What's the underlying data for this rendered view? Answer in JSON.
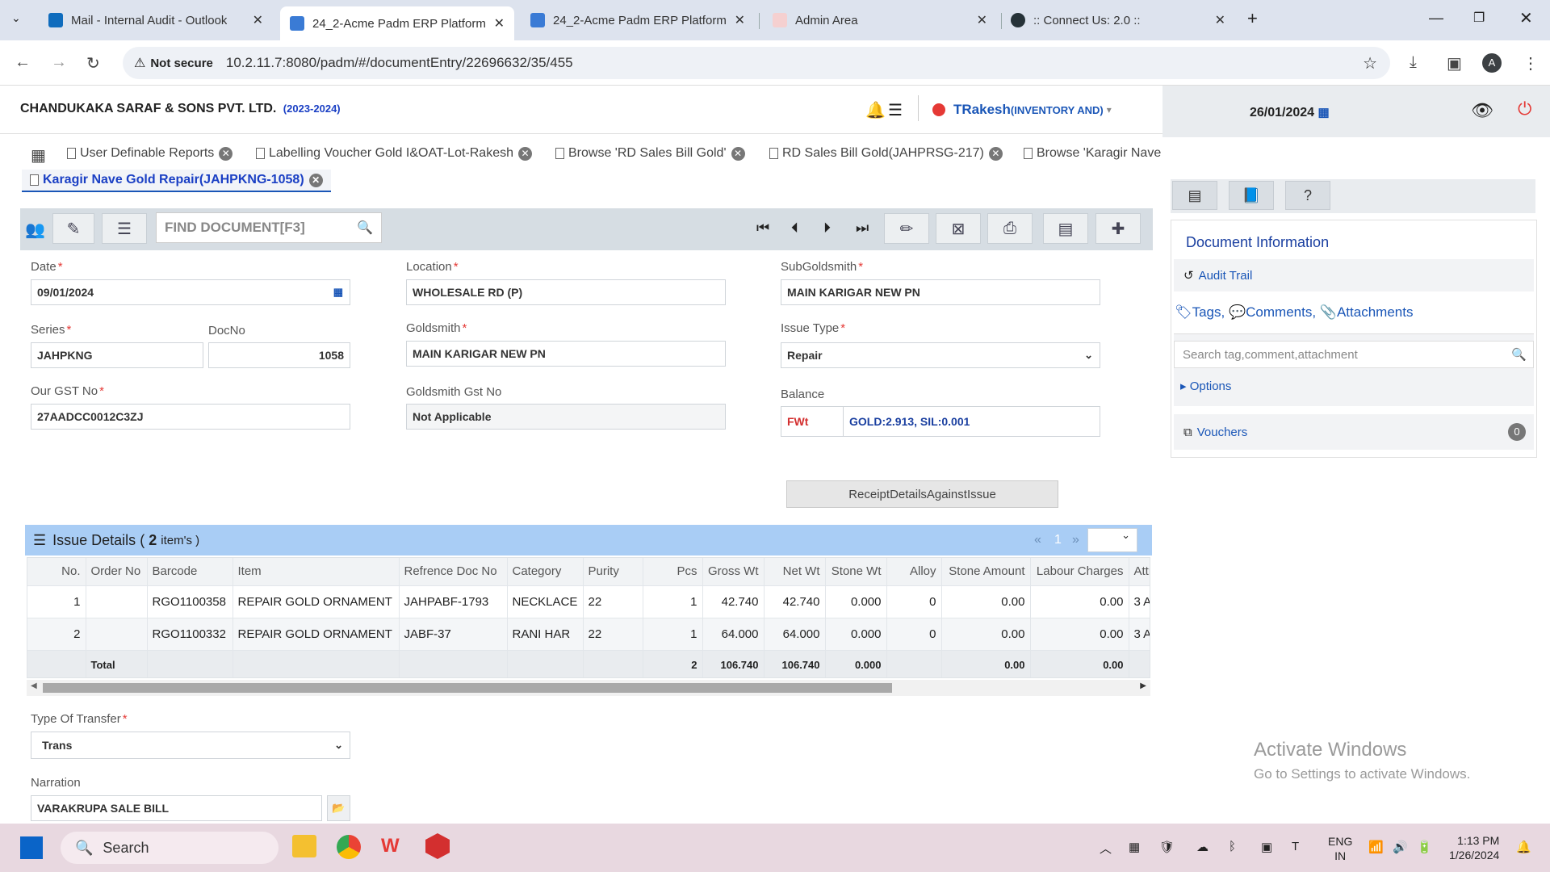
{
  "browser": {
    "tabs": [
      {
        "label": "Mail - Internal Audit - Outlook",
        "favicon_color": "#0f6cbd"
      },
      {
        "label": "24_2-Acme Padm ERP Platform",
        "favicon_color": "#2e7d32"
      },
      {
        "label": "24_2-Acme Padm ERP Platform",
        "favicon_color": "#2e7d32"
      },
      {
        "label": "Admin Area",
        "favicon_color": "#c62828"
      },
      {
        "label": ":: Connect Us: 2.0 ::",
        "favicon_color": "#263238"
      }
    ],
    "security": "Not secure",
    "url": "10.2.11.7:8080/padm/#/documentEntry/22696632/35/455",
    "profile_initial": "A"
  },
  "app": {
    "company": "CHANDUKAKA SARAF & SONS PVT. LTD.",
    "year": "(2023-2024)",
    "user": "TRakesh",
    "role": "(INVENTORY AND)",
    "date": "26/01/2024"
  },
  "doctabs": [
    {
      "label": "User Definable Reports"
    },
    {
      "label": "Labelling Voucher Gold I&OAT-Lot-Rakesh"
    },
    {
      "label": "Browse 'RD Sales Bill Gold'"
    },
    {
      "label": "RD Sales Bill Gold(JAHPRSG-217)"
    },
    {
      "label": "Browse 'Karagir Nave"
    },
    {
      "label": "Karagir Nave Gold Repair(JAHPKNG-1058)"
    }
  ],
  "toolbar": {
    "find_placeholder": "FIND DOCUMENT[F3]"
  },
  "form": {
    "date_label": "Date",
    "date": "09/01/2024",
    "series_label": "Series",
    "series": "JAHPKNG",
    "docno_label": "DocNo",
    "docno": "1058",
    "gst_label": "Our GST No",
    "gst": "27AADCC0012C3ZJ",
    "location_label": "Location",
    "location": "WHOLESALE RD (P)",
    "goldsmith_label": "Goldsmith",
    "goldsmith": "MAIN KARIGAR NEW PN",
    "goldsmith_gst_label": "Goldsmith Gst No",
    "goldsmith_gst": "Not Applicable",
    "subgoldsmith_label": "SubGoldsmith",
    "subgoldsmith": "MAIN KARIGAR NEW PN",
    "issue_type_label": "Issue Type",
    "issue_type": "Repair",
    "balance_label": "Balance",
    "balance_tag": "FWt",
    "balance": "GOLD:2.913, SIL:0.001",
    "receipt_button": "ReceiptDetailsAgainstIssue",
    "transfer_label": "Type Of Transfer",
    "transfer": "Trans",
    "narration_label": "Narration",
    "narration": "VARAKRUPA SALE BILL"
  },
  "issue": {
    "title": "Issue Details",
    "open": "(",
    "count": "2",
    "suffix": "item's )",
    "page": "1",
    "page_prev": "«",
    "page_next": "»",
    "columns": [
      "No.",
      "Order No",
      "Barcode",
      "Item",
      "Refrence Doc No",
      "Category",
      "Purity",
      "Pcs",
      "Gross Wt",
      "Net Wt",
      "Stone Wt",
      "Alloy",
      "Stone Amount",
      "Labour Charges",
      "Attr"
    ],
    "rows": [
      [
        "1",
        "",
        "RGO1100358",
        "REPAIR GOLD ORNAMENT",
        "JAHPABF-1793",
        "NECKLACE",
        "22",
        "1",
        "42.740",
        "42.740",
        "0.000",
        "0",
        "0.00",
        "0.00",
        "3 A"
      ],
      [
        "2",
        "",
        "RGO1100332",
        "REPAIR GOLD ORNAMENT",
        "JABF-37",
        "RANI HAR",
        "22",
        "1",
        "64.000",
        "64.000",
        "0.000",
        "0",
        "0.00",
        "0.00",
        "3 A"
      ]
    ],
    "total": [
      "",
      "Total",
      "",
      "",
      "",
      "",
      "",
      "2",
      "106.740",
      "106.740",
      "0.000",
      "",
      "0.00",
      "0.00",
      ""
    ]
  },
  "rightpanel": {
    "title": "Document Information",
    "audit": "Audit Trail",
    "tags": "Tags,",
    "comments": "Comments,",
    "attachments": "Attachments",
    "search_placeholder": "Search tag,comment,attachment",
    "options": "Options",
    "vouchers": "Vouchers",
    "vouchers_count": "0"
  },
  "watermark": {
    "line1": "Activate Windows",
    "line2": "Go to Settings to activate Windows."
  },
  "taskbar": {
    "search": "Search",
    "lang1": "ENG",
    "lang2": "IN",
    "time": "1:13 PM",
    "date": "1/26/2024"
  }
}
